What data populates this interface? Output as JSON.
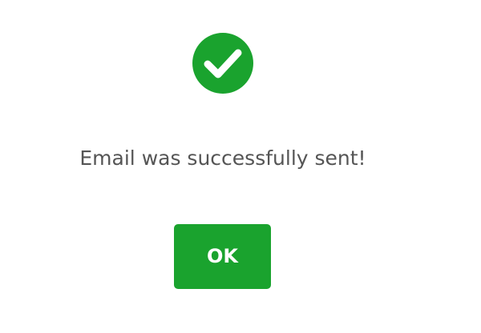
{
  "dialog": {
    "icon": "check-circle-icon",
    "message": "Email was successfully sent!",
    "ok_label": "OK"
  },
  "colors": {
    "accent": "#1aa32e",
    "background": "#ffffff",
    "text": "#555555",
    "button_text": "#ffffff"
  }
}
